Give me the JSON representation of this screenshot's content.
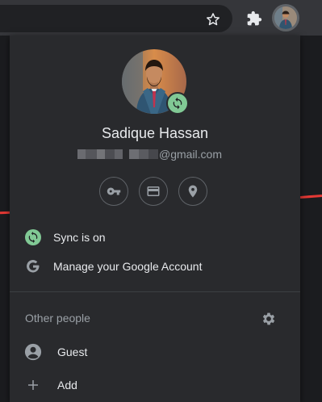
{
  "toolbar": {
    "icons": [
      "star-icon",
      "extensions-icon",
      "profile-avatar"
    ]
  },
  "profile": {
    "name": "Sadique Hassan",
    "email_visible": "@gmail.com",
    "sync_badge_color": "#81c995"
  },
  "quick_actions": [
    {
      "icon": "key-icon",
      "label": "Passwords"
    },
    {
      "icon": "credit-card-icon",
      "label": "Payment methods"
    },
    {
      "icon": "location-pin-icon",
      "label": "Addresses"
    }
  ],
  "menu": {
    "sync_label": "Sync is on",
    "manage_account_label": "Manage your Google Account"
  },
  "other_people": {
    "header": "Other people",
    "guest_label": "Guest",
    "add_label": "Add"
  },
  "colors": {
    "panel_bg": "#292a2d",
    "text_primary": "#e8eaed",
    "text_secondary": "#9aa0a6",
    "sync_green": "#81c995"
  }
}
